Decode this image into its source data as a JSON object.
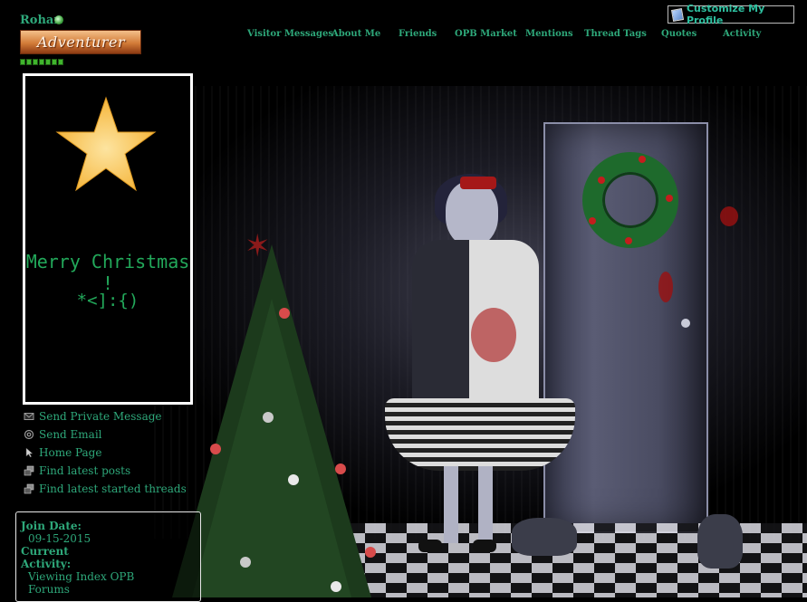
{
  "profile": {
    "username": "Rohan",
    "rank_title": "Adventurer"
  },
  "nav": {
    "items": [
      {
        "label": "Visitor Messages"
      },
      {
        "label": "About Me"
      },
      {
        "label": "Friends"
      },
      {
        "label": "OPB Market"
      },
      {
        "label": "Mentions"
      },
      {
        "label": "Thread Tags"
      },
      {
        "label": "Quotes"
      },
      {
        "label": "Activity"
      }
    ],
    "customize_label": "Customize My Profile"
  },
  "avatar": {
    "line1": "Merry Christmas !",
    "line2": "*<]:{)"
  },
  "contact": {
    "items": [
      {
        "label": "Send Private Message",
        "icon": "envelope-icon"
      },
      {
        "label": "Send Email",
        "icon": "at-icon"
      },
      {
        "label": "Home Page",
        "icon": "cursor-icon"
      },
      {
        "label": "Find latest posts",
        "icon": "posts-icon"
      },
      {
        "label": "Find latest started threads",
        "icon": "threads-icon"
      }
    ]
  },
  "info": {
    "join_date_label": "Join Date:",
    "join_date_value": "09-15-2015",
    "current_activity_label_1": "Current",
    "current_activity_label_2": "Activity:",
    "current_activity_value_1": "Viewing Index OPB",
    "current_activity_value_2": "Forums"
  },
  "colors": {
    "accent": "#2ea87a",
    "background": "#000000"
  }
}
